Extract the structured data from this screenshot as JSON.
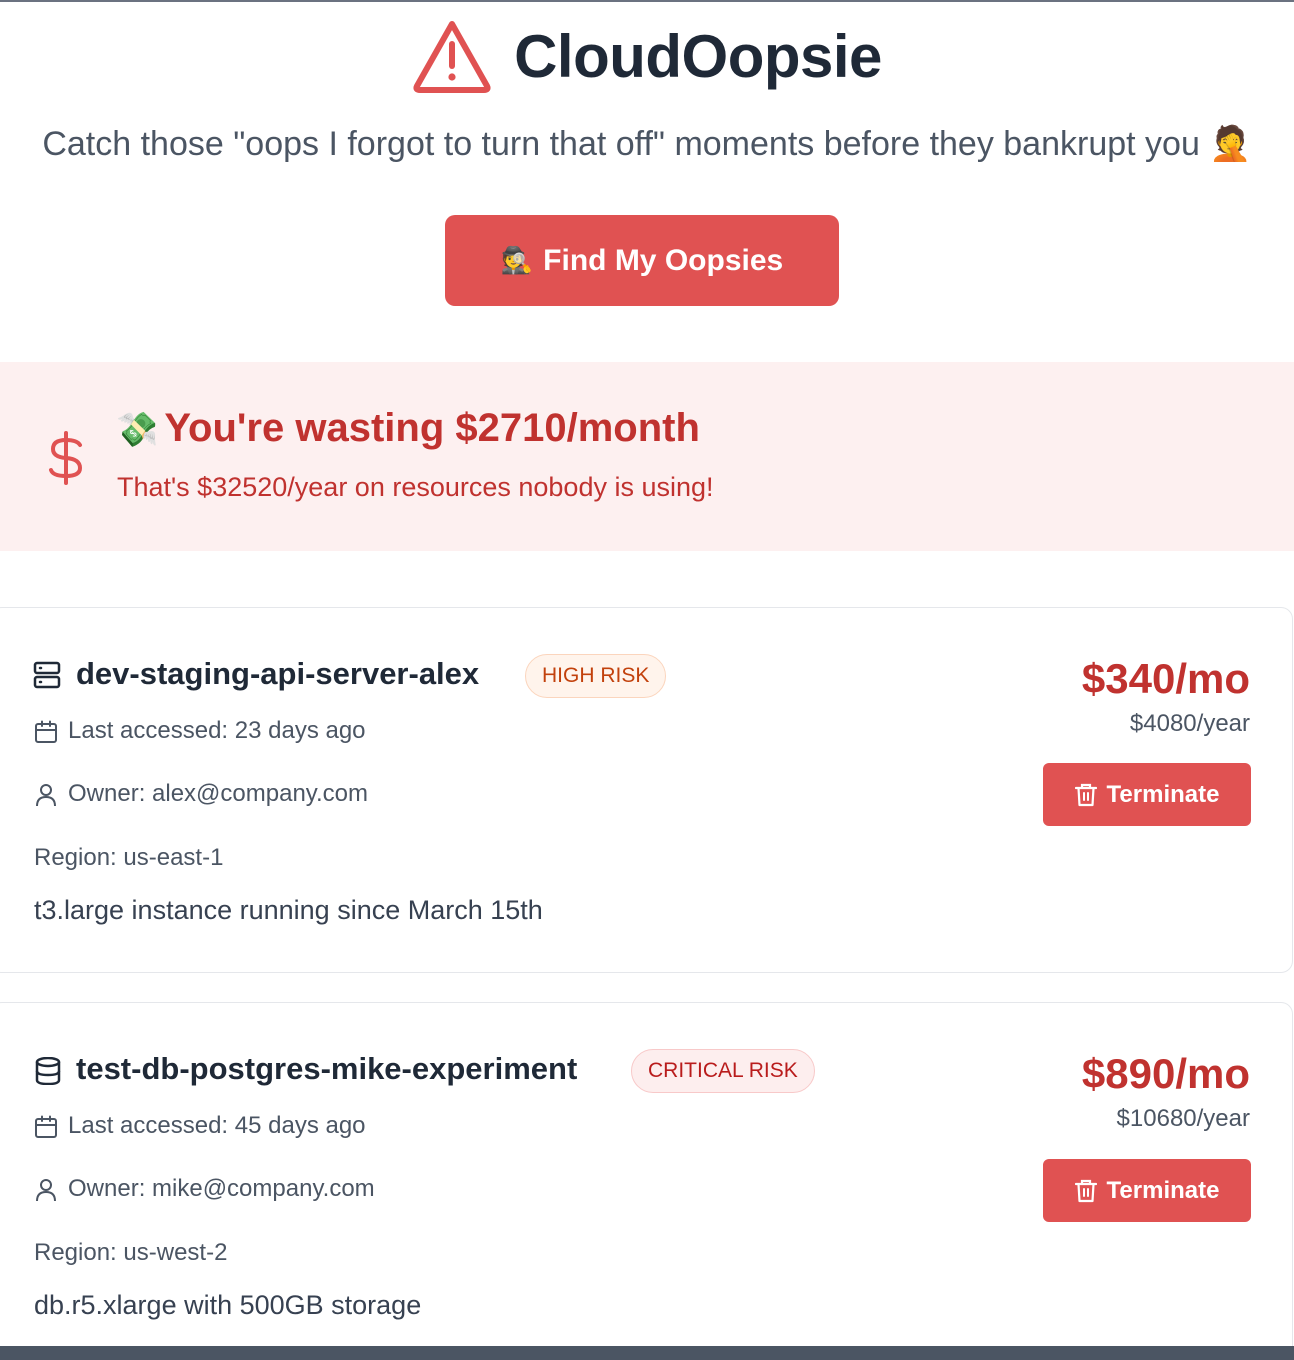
{
  "app": {
    "title": "CloudOopsie",
    "tagline": "Catch those \"oops I forgot to turn that off\" moments before they bankrupt you 🤦",
    "scan_button_emoji": "🕵️",
    "scan_button_label": "Find My Oopsies"
  },
  "summary": {
    "emoji": "💸",
    "title": "You're wasting $2710/month",
    "subtitle": "That's $32520/year on resources nobody is using!"
  },
  "resources": [
    {
      "icon": "server-icon",
      "name": "dev-staging-api-server-alex",
      "risk": "HIGH RISK",
      "last_accessed": "Last accessed: 23 days ago",
      "owner": "Owner: alex@company.com",
      "region": "Region: us-east-1",
      "description": "t3.large instance running since March 15th",
      "cost_month": "$340/mo",
      "cost_year": "$4080/year",
      "action_label": "Terminate"
    },
    {
      "icon": "database-icon",
      "name": "test-db-postgres-mike-experiment",
      "risk": "CRITICAL RISK",
      "last_accessed": "Last accessed: 45 days ago",
      "owner": "Owner: mike@company.com",
      "region": "Region: us-west-2",
      "description": "db.r5.xlarge with 500GB storage",
      "cost_month": "$890/mo",
      "cost_year": "$10680/year",
      "action_label": "Terminate"
    }
  ],
  "colors": {
    "accent": "#e05252",
    "danger_text": "#c0322f",
    "banner_bg": "#fdf0f0"
  }
}
